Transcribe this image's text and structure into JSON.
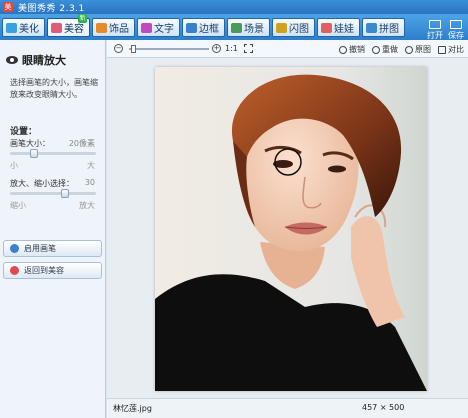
{
  "window": {
    "title": "美图秀秀 2.3.1"
  },
  "menu": {
    "tabs": [
      {
        "label": "美化",
        "color": "#3aa0e0"
      },
      {
        "label": "美容",
        "color": "#e05a7a"
      },
      {
        "label": "饰品",
        "color": "#e88a2a"
      },
      {
        "label": "文字",
        "color": "#c04ac0"
      },
      {
        "label": "边框",
        "color": "#3a7fd0"
      },
      {
        "label": "场景",
        "color": "#4a9a5a"
      },
      {
        "label": "闪图",
        "color": "#d0a020"
      },
      {
        "label": "娃娃",
        "color": "#e06060"
      },
      {
        "label": "拼图",
        "color": "#3a8ad0"
      }
    ],
    "active_tab": "美容",
    "badge": "新",
    "right_tools": [
      {
        "label": "打开"
      },
      {
        "label": "保存"
      }
    ]
  },
  "left_panel": {
    "title": "眼睛放大",
    "description": "选择画笔的大小，画笔缩放来改变眼睛大小。",
    "settings_title": "设置：",
    "brush_size": {
      "label": "画笔大小：",
      "value": "20像素",
      "min_label": "小",
      "max_label": "大",
      "level": 0.25
    },
    "zoom_select": {
      "label": "放大、缩小选择：",
      "value": "30",
      "min_label": "缩小",
      "max_label": "放大",
      "level": 0.65
    },
    "buttons": [
      {
        "label": "启用画笔",
        "icon": "brush-icon",
        "color": "#3a7fd0"
      },
      {
        "label": "返回到美容",
        "icon": "back-icon",
        "color": "#e04a4a"
      }
    ]
  },
  "toolbar": {
    "zoom_ratio": "1:1",
    "undo": "撤销",
    "redo": "重做",
    "original": "原图",
    "compare": "对比"
  },
  "status": {
    "filename": "林忆莲.jpg",
    "dimensions": "457 × 500"
  }
}
